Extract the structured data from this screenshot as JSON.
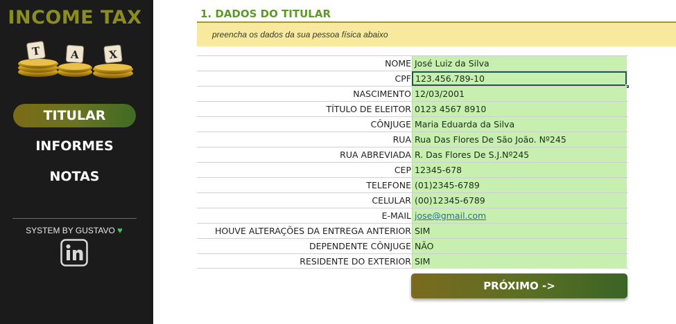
{
  "sidebar": {
    "brand": "INCOME TAX",
    "logo_letters": [
      "T",
      "A",
      "X"
    ],
    "nav": [
      {
        "label": "TITULAR",
        "active": true
      },
      {
        "label": "INFORMES",
        "active": false
      },
      {
        "label": "NOTAS",
        "active": false
      }
    ],
    "credit": "SYSTEM BY GUSTAVO",
    "credit_icon": "green-heart-icon",
    "social_icon": "linkedin-icon"
  },
  "main": {
    "section_title": "1. DADOS DO TITULAR",
    "hint": "preencha os dados da sua pessoa física abaixo",
    "fields": [
      {
        "label": "NOME",
        "value": "José Luiz da Silva"
      },
      {
        "label": "CPF",
        "value": "123.456.789-10"
      },
      {
        "label": "NASCIMENTO",
        "value": "12/03/2001"
      },
      {
        "label": "TÍTULO DE ELEITOR",
        "value": "0123 4567 8910"
      },
      {
        "label": "CÔNJUGE",
        "value": "Maria Eduarda da Silva"
      },
      {
        "label": "RUA",
        "value": "Rua Das Flores De São João. Nº245"
      },
      {
        "label": "RUA ABREVIADA",
        "value": "R. Das Flores De S.J.Nº245"
      },
      {
        "label": "CEP",
        "value": "12345-678"
      },
      {
        "label": "TELEFONE",
        "value": "(01)2345-6789"
      },
      {
        "label": "CELULAR",
        "value": "(00)12345-6789"
      },
      {
        "label": "E-MAIL",
        "value": "jose@gmail.com"
      },
      {
        "label": "HOUVE ALTERAÇÕES DA ENTREGA ANTERIOR",
        "value": "SIM"
      },
      {
        "label": "DEPENDENTE CÔNJUGE",
        "value": "NÃO"
      },
      {
        "label": "RESIDENTE DO EXTERIOR",
        "value": "SIM"
      }
    ],
    "next_button": "PRÓXIMO ->"
  },
  "colors": {
    "sidebar_bg": "#1b1b1b",
    "brand": "#8b8d1e",
    "accent_green": "#5c9a25",
    "field_bg": "#c6efb0",
    "hint_bg": "#f7ea9f"
  }
}
